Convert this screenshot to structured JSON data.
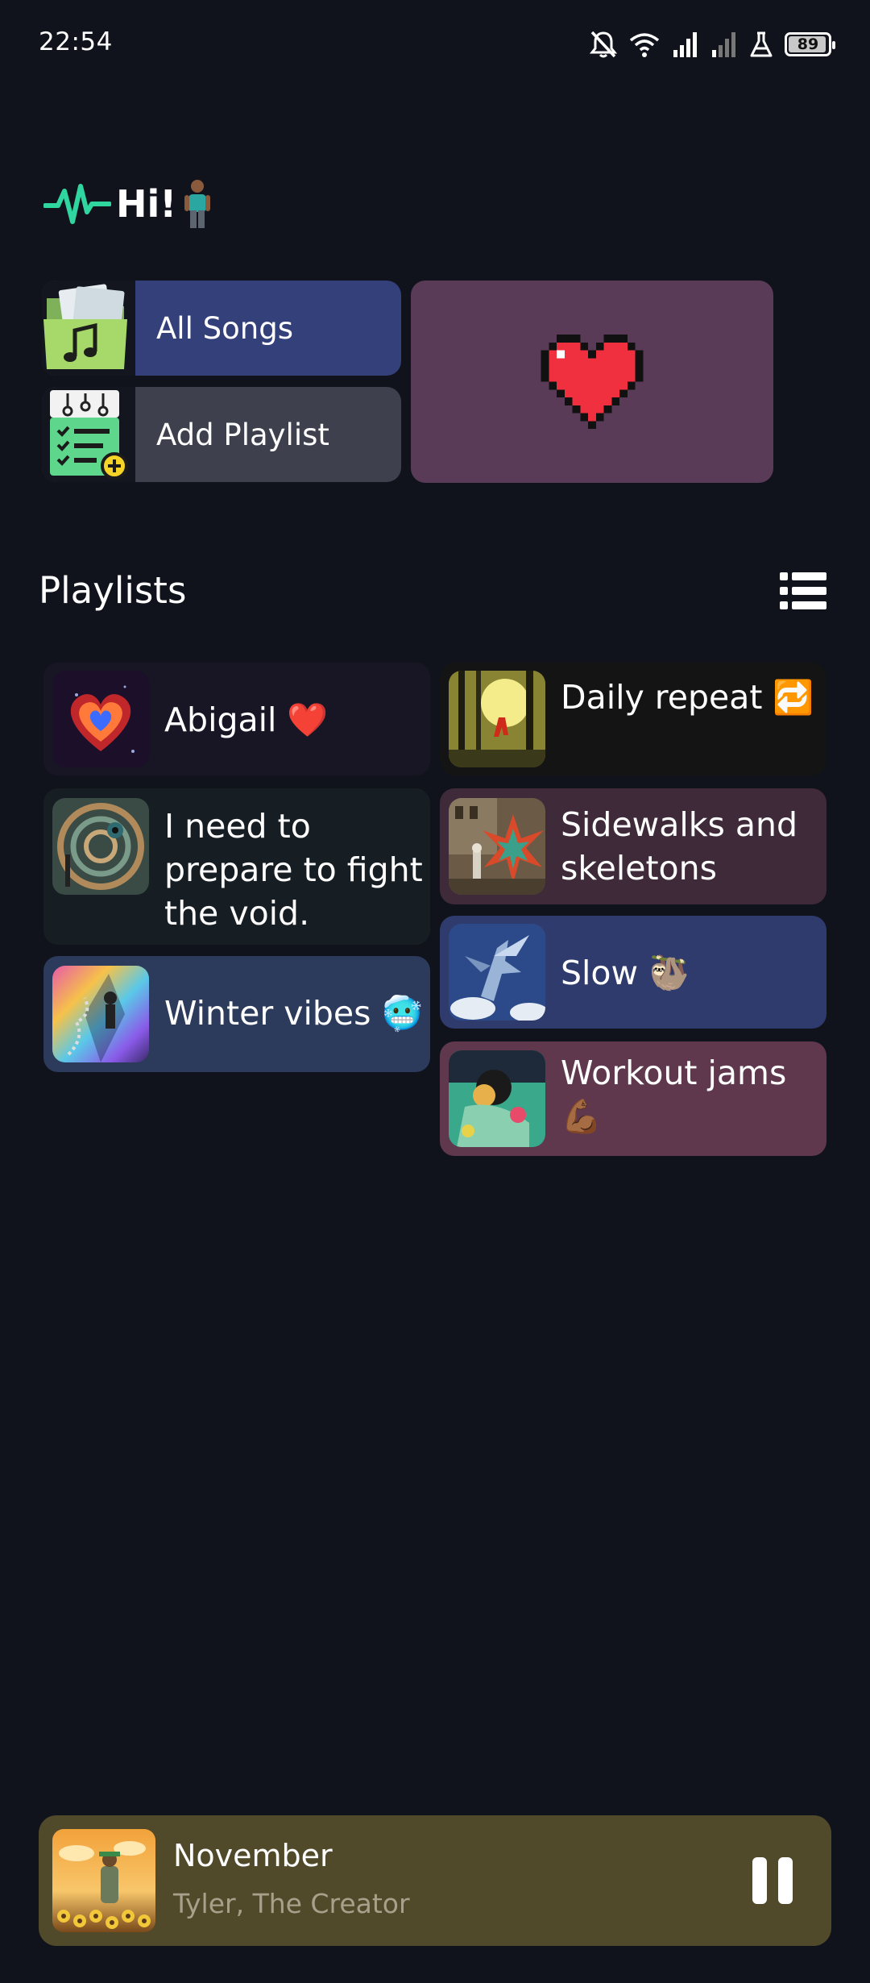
{
  "status_bar": {
    "time": "22:54",
    "battery": "89",
    "battery_level": 0.89,
    "icons": [
      "bell-off-icon",
      "wifi-icon",
      "signal-icon",
      "signal-weak-icon",
      "flask-icon",
      "battery-icon"
    ]
  },
  "header": {
    "logo_icon": "pulse-icon",
    "greeting": "Hi!",
    "emoji": "🧍🏾‍♂️",
    "accent_color": "#2fd6a0"
  },
  "quick_actions": {
    "all_songs": {
      "label": "All Songs",
      "icon": "music-folder-icon",
      "color": "#34407a"
    },
    "add_playlist": {
      "label": "Add Playlist",
      "icon": "add-playlist-icon",
      "color": "#3e414d"
    },
    "favorites": {
      "icon": "pixel-heart-icon",
      "color": "#5a3b57"
    }
  },
  "playlists_section": {
    "title": "Playlists",
    "view_toggle_icon": "list-view-icon"
  },
  "playlists": [
    {
      "title": "Abigail ❤️",
      "color": "#181624"
    },
    {
      "title": "Daily repeat 🔁",
      "color": "#141414"
    },
    {
      "title": "I need to\nprepare to fight\nthe void.",
      "color": "#161e24"
    },
    {
      "title": "Sidewalks and\nskeletons",
      "color": "#3f2a3a"
    },
    {
      "title": "Winter vibes 🥶",
      "color": "#2c3a5c"
    },
    {
      "title": "Slow 🦥",
      "color": "#2f3b6c"
    },
    {
      "title": "Workout jams\n💪🏾",
      "color": "#5f384d"
    }
  ],
  "now_playing": {
    "title": "November",
    "artist": "Tyler, The Creator",
    "pause_icon": "pause-icon",
    "color": "#514a2a"
  }
}
